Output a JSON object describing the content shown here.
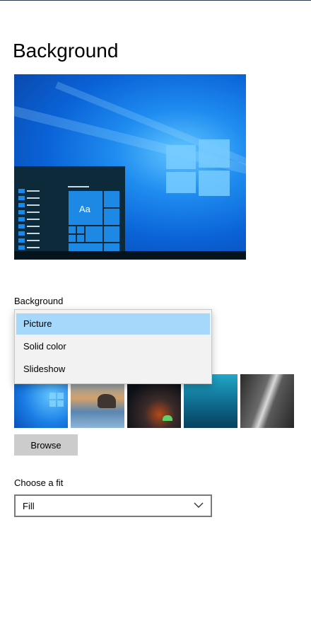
{
  "page": {
    "title": "Background"
  },
  "preview": {
    "tile_text": "Aa"
  },
  "background_field": {
    "label": "Background",
    "options": [
      "Picture",
      "Solid color",
      "Slideshow"
    ],
    "selected": "Picture"
  },
  "thumbnails": [
    "wallpaper-windows",
    "wallpaper-beach-rocks",
    "wallpaper-night-tent",
    "wallpaper-underwater",
    "wallpaper-waterfall-cliff"
  ],
  "browse": {
    "label": "Browse"
  },
  "fit": {
    "label": "Choose a fit",
    "value": "Fill"
  },
  "colors": {
    "accent": "#0078d7",
    "selected_option": "#a6d8fb",
    "button": "#cccccc"
  }
}
